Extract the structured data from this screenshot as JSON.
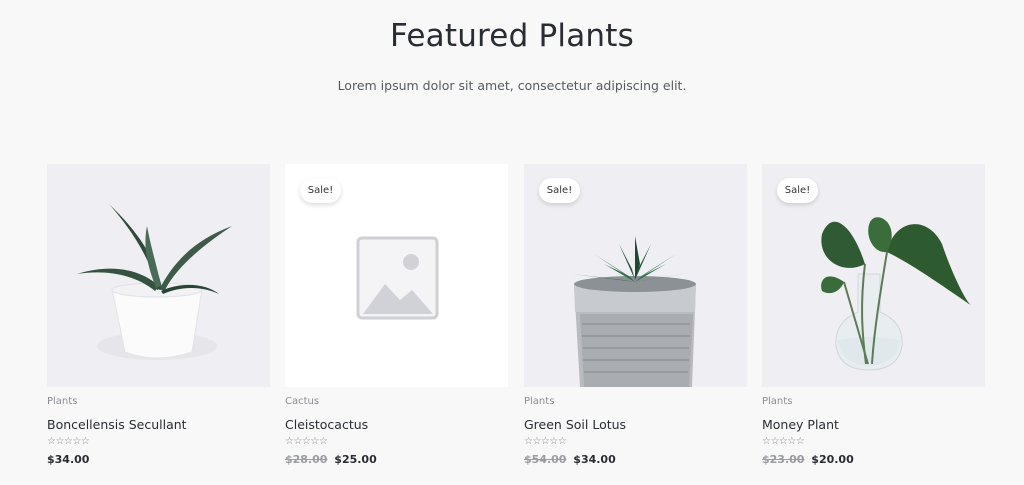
{
  "section": {
    "title": "Featured Plants",
    "subtitle": "Lorem ipsum dolor sit amet, consectetur adipiscing elit."
  },
  "products": [
    {
      "category": "Plants",
      "name": "Boncellensis Secullant",
      "rating_stars": "☆☆☆☆☆",
      "price": "$34.00",
      "old_price": "",
      "sale": false
    },
    {
      "category": "Cactus",
      "name": "Cleistocactus",
      "rating_stars": "☆☆☆☆☆",
      "price": "$25.00",
      "old_price": "$28.00",
      "sale": true,
      "sale_label": "Sale!"
    },
    {
      "category": "Plants",
      "name": "Green Soil Lotus",
      "rating_stars": "☆☆☆☆☆",
      "price": "$34.00",
      "old_price": "$54.00",
      "sale": true,
      "sale_label": "Sale!"
    },
    {
      "category": "Plants",
      "name": "Money Plant",
      "rating_stars": "☆☆☆☆☆",
      "price": "$20.00",
      "old_price": "$23.00",
      "sale": true,
      "sale_label": "Sale!"
    }
  ],
  "icons": {
    "placeholder": "image-placeholder-icon",
    "star": "star-outline-icon"
  }
}
